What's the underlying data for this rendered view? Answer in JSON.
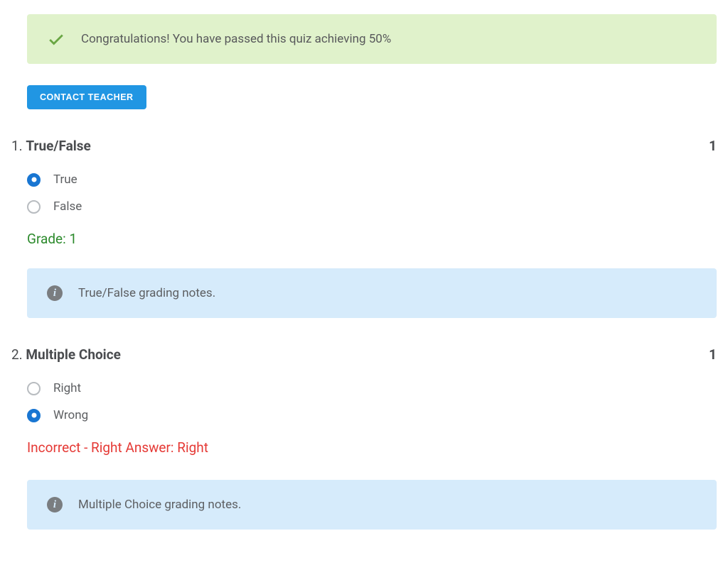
{
  "banner": {
    "text": "Congratulations! You have passed this quiz achieving 50%"
  },
  "contact_button_label": "CONTACT TEACHER",
  "questions": [
    {
      "number": "1.",
      "title": "True/False",
      "points": "1",
      "options": [
        {
          "label": "True",
          "selected": true
        },
        {
          "label": "False",
          "selected": false
        }
      ],
      "grade_text": "Grade: 1",
      "grade_correct": true,
      "note": "True/False grading notes."
    },
    {
      "number": "2.",
      "title": "Multiple Choice",
      "points": "1",
      "options": [
        {
          "label": "Right",
          "selected": false
        },
        {
          "label": "Wrong",
          "selected": true
        }
      ],
      "grade_text": "Incorrect - Right Answer: Right",
      "grade_correct": false,
      "note": "Multiple Choice grading notes."
    }
  ]
}
